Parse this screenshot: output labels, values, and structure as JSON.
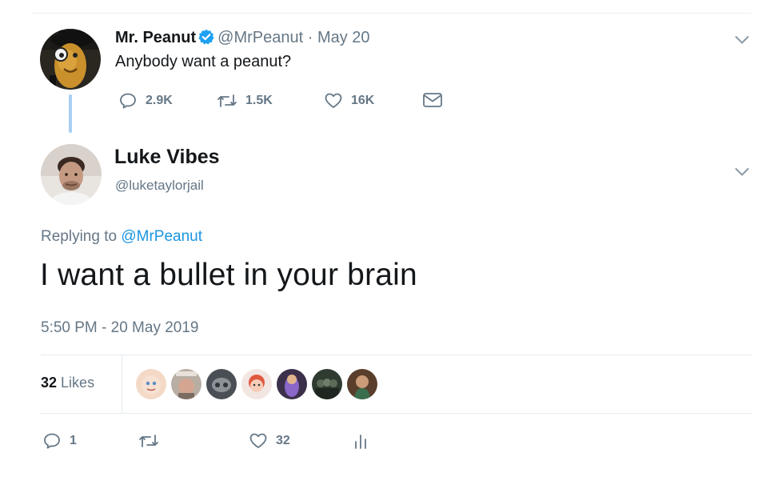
{
  "parent_tweet": {
    "display_name": "Mr. Peanut",
    "handle": "@MrPeanut",
    "separator": "·",
    "date": "May 20",
    "text": "Anybody want a peanut?",
    "replies": "2.9K",
    "retweets": "1.5K",
    "likes": "16K",
    "verified": true
  },
  "reply_tweet": {
    "display_name": "Luke Vibes",
    "handle": "@luketaylorjail",
    "replying_prefix": "Replying to",
    "replying_to": "@MrPeanut",
    "text": "I want a bullet in your brain",
    "timestamp": "5:50 PM - 20 May 2019",
    "likes_count": "32",
    "likes_label": "Likes",
    "reply_count": "1",
    "like_count": "32"
  },
  "icons": {
    "reply": "reply-icon",
    "retweet": "retweet-icon",
    "like": "heart-icon",
    "dm": "envelope-icon",
    "more": "chevron-down-icon",
    "analytics": "analytics-icon",
    "verified": "verified-badge-icon"
  },
  "colors": {
    "accent": "#1b95e0",
    "verified": "#1da1f2",
    "muted": "#657786",
    "text": "#14171a",
    "thread_line": "#a9cff2"
  }
}
